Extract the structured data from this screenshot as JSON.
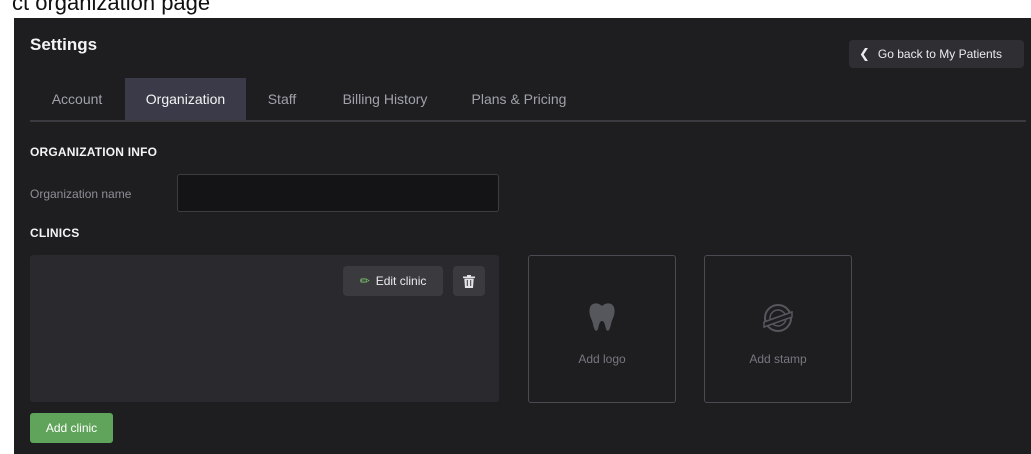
{
  "header_fragment": "ct organization page",
  "page": {
    "title": "Settings",
    "back_button": "Go back to My Patients"
  },
  "tabs": [
    {
      "label": "Account",
      "active": false
    },
    {
      "label": "Organization",
      "active": true
    },
    {
      "label": "Staff",
      "active": false
    },
    {
      "label": "Billing History",
      "active": false
    },
    {
      "label": "Plans & Pricing",
      "active": false
    }
  ],
  "organization_info": {
    "heading": "ORGANIZATION INFO",
    "name_label": "Organization name",
    "name_value": ""
  },
  "clinics": {
    "heading": "CLINICS",
    "edit_label": "Edit clinic",
    "add_logo_label": "Add logo",
    "add_stamp_label": "Add stamp",
    "add_clinic_label": "Add clinic"
  },
  "colors": {
    "background": "#1e1e21",
    "active_tab": "#3a3a48",
    "accent_green": "#5fa45a"
  },
  "icons": {
    "back": "chevron-left-icon",
    "edit": "pencil-icon",
    "delete": "trash-icon",
    "logo": "tooth-icon",
    "stamp": "stamp-icon"
  }
}
